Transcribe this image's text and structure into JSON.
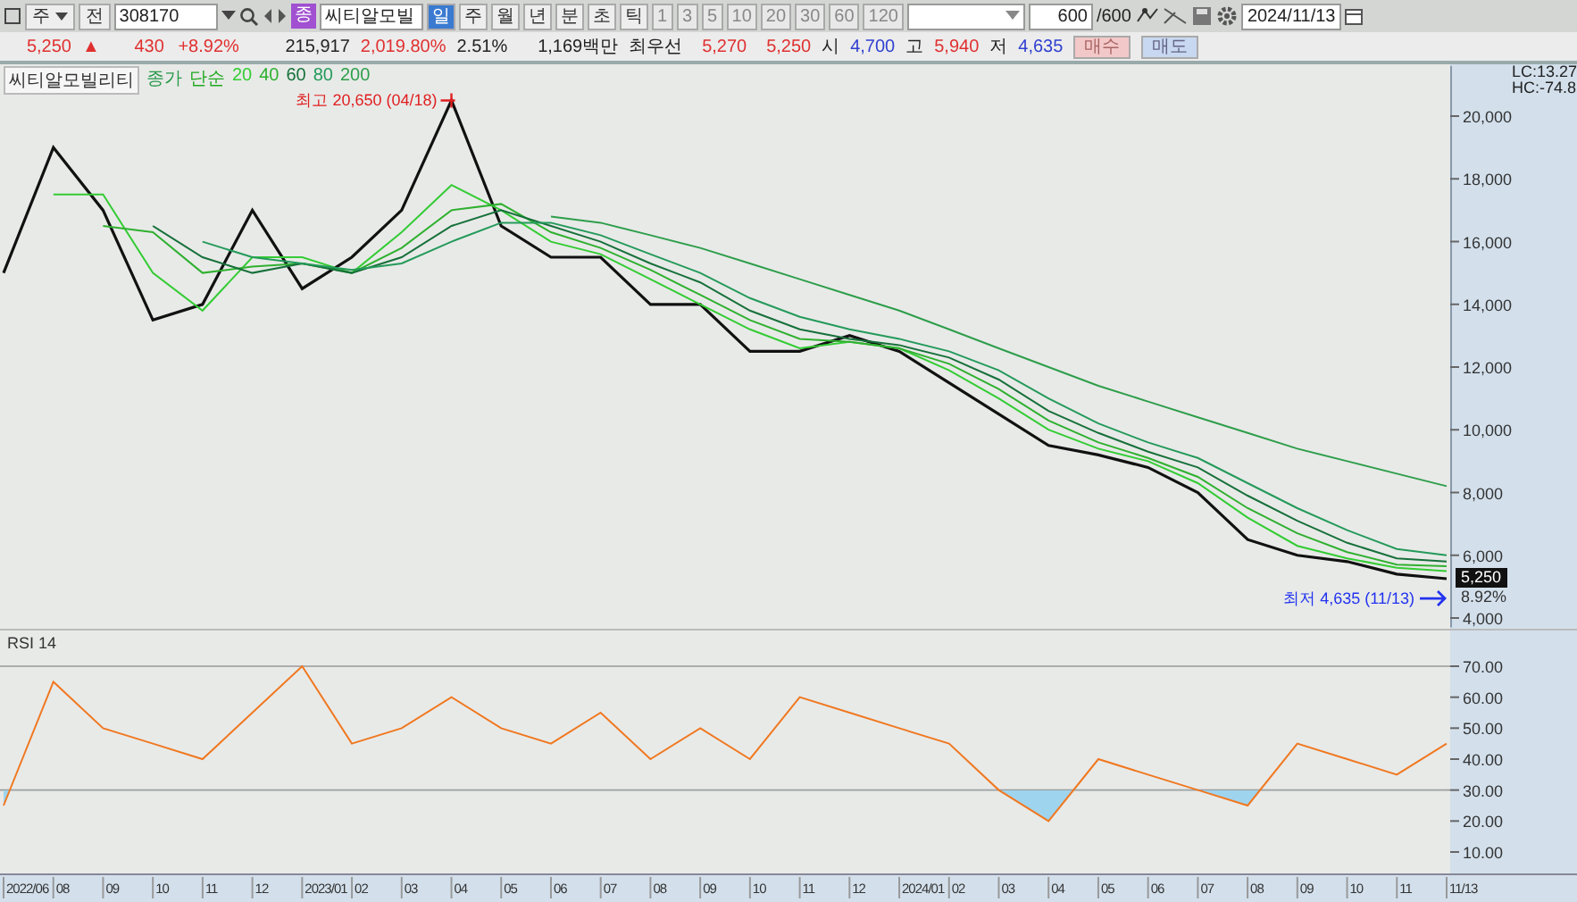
{
  "toolbar": {
    "market": "주",
    "type": "전",
    "code": "308170",
    "badge": "종",
    "name": "씨티알모빌",
    "periods": [
      {
        "label": "일",
        "selected": true
      },
      {
        "label": "주",
        "selected": false
      },
      {
        "label": "월",
        "selected": false
      },
      {
        "label": "년",
        "selected": false
      },
      {
        "label": "분",
        "selected": false
      },
      {
        "label": "초",
        "selected": false
      },
      {
        "label": "틱",
        "selected": false
      }
    ],
    "intervals": [
      {
        "label": "1",
        "selected": false
      },
      {
        "label": "3",
        "selected": false
      },
      {
        "label": "5",
        "selected": false
      },
      {
        "label": "10",
        "selected": false
      },
      {
        "label": "20",
        "selected": false
      },
      {
        "label": "30",
        "selected": false
      },
      {
        "label": "60",
        "selected": false
      },
      {
        "label": "120",
        "selected": false
      }
    ],
    "count": "600",
    "count_max": "/600",
    "date": "2024/11/13"
  },
  "quote": {
    "price": "5,250",
    "arrow": "▲",
    "change": "430",
    "change_pct": "+8.92%",
    "volume": "215,917",
    "volume_pct": "2,019.80%",
    "turnover": "2.51%",
    "amount": "1,169백만",
    "best_label": "최우선",
    "ask": "5,270",
    "bid": "5,250",
    "open_label": "시",
    "open": "4,700",
    "high_label": "고",
    "high": "5,940",
    "low_label": "저",
    "low": "4,635",
    "buttons": [
      {
        "label": "매수",
        "kind": "buy"
      },
      {
        "label": "매도",
        "kind": "sell"
      }
    ]
  },
  "price_pane": {
    "legend_name": "씨티알모빌리티",
    "legend_ma": "단순",
    "lc": "LC:13.27",
    "hc": "HC:-74.8",
    "high_mark": "최고 20,650 (04/18)",
    "low_mark": "최저 4,635 (11/13)",
    "price_tag": "5,250",
    "pct_tag": "8.92%",
    "chart_data": {
      "type": "line",
      "ylim": [
        3700,
        21600
      ],
      "yticks": [
        {
          "value": 20000,
          "label": "20,000"
        },
        {
          "value": 18000,
          "label": "18,000"
        },
        {
          "value": 16000,
          "label": "16,000"
        },
        {
          "value": 14000,
          "label": "14,000"
        },
        {
          "value": 12000,
          "label": "12,000"
        },
        {
          "value": 10000,
          "label": "10,000"
        },
        {
          "value": 8000,
          "label": "8,000"
        },
        {
          "value": 6000,
          "label": "6,000"
        },
        {
          "value": 4000,
          "label": "4,000"
        }
      ],
      "series": [
        {
          "name": "종가",
          "color": "#111111",
          "values": [
            15000,
            19000,
            17000,
            13500,
            14000,
            17000,
            14500,
            15500,
            17000,
            20500,
            16500,
            15500,
            15500,
            14000,
            14000,
            12500,
            12500,
            13000,
            12500,
            11500,
            10500,
            9500,
            9200,
            8800,
            8000,
            6500,
            6000,
            5800,
            5400,
            5250
          ]
        },
        {
          "name": "20",
          "color": "#33cc33",
          "values": [
            null,
            17500,
            17500,
            15000,
            13800,
            15500,
            15500,
            15000,
            16300,
            17800,
            17000,
            16000,
            15600,
            14800,
            14000,
            13200,
            12600,
            12800,
            12600,
            11900,
            11000,
            10000,
            9400,
            9000,
            8300,
            7200,
            6300,
            5900,
            5600,
            5500
          ]
        },
        {
          "name": "40",
          "color": "#2fb02f",
          "values": [
            null,
            null,
            16500,
            16300,
            15000,
            15200,
            15300,
            15000,
            15800,
            17000,
            17200,
            16300,
            15800,
            15100,
            14300,
            13500,
            12900,
            12800,
            12600,
            12100,
            11300,
            10300,
            9600,
            9100,
            8500,
            7500,
            6700,
            6100,
            5700,
            5650
          ]
        },
        {
          "name": "60",
          "color": "#17703a",
          "values": [
            null,
            null,
            null,
            16500,
            15500,
            15000,
            15300,
            15000,
            15500,
            16500,
            17000,
            16500,
            16000,
            15300,
            14700,
            13800,
            13200,
            12900,
            12700,
            12300,
            11600,
            10600,
            9900,
            9300,
            8800,
            7900,
            7100,
            6400,
            5900,
            5800
          ]
        },
        {
          "name": "80",
          "color": "#249a5a",
          "values": [
            null,
            null,
            null,
            null,
            16000,
            15500,
            15300,
            15100,
            15300,
            16000,
            16600,
            16600,
            16200,
            15600,
            15000,
            14200,
            13600,
            13200,
            12900,
            12500,
            11900,
            11000,
            10200,
            9600,
            9100,
            8300,
            7500,
            6800,
            6200,
            6000
          ]
        },
        {
          "name": "200",
          "color": "#2e9e4a",
          "values": [
            null,
            null,
            null,
            null,
            null,
            null,
            null,
            null,
            null,
            null,
            null,
            16800,
            16600,
            16200,
            15800,
            15300,
            14800,
            14300,
            13800,
            13200,
            12600,
            12000,
            11400,
            10900,
            10400,
            9900,
            9400,
            9000,
            8600,
            8200
          ]
        }
      ]
    }
  },
  "rsi_pane": {
    "chart_data": {
      "type": "line",
      "categories": [
        "2022/06",
        "08",
        "09",
        "10",
        "11",
        "12",
        "2023/01",
        "02",
        "03",
        "04",
        "05",
        "06",
        "07",
        "08",
        "09",
        "10",
        "11",
        "12",
        "2024/01",
        "02",
        "03",
        "04",
        "05",
        "06",
        "07",
        "08",
        "09",
        "10",
        "11",
        "11/13"
      ],
      "ylim": [
        10,
        70
      ],
      "yticks": [
        {
          "value": 70,
          "label": "70.00"
        },
        {
          "value": 60,
          "label": "60.00"
        },
        {
          "value": 50,
          "label": "50.00"
        },
        {
          "value": 40,
          "label": "40.00"
        },
        {
          "value": 30,
          "label": "30.00"
        },
        {
          "value": 20,
          "label": "20.00"
        },
        {
          "value": 10,
          "label": "10.00"
        }
      ],
      "series": [
        {
          "name": "RSI 14",
          "color": "#f07820",
          "values": [
            25,
            65,
            50,
            45,
            40,
            55,
            70,
            45,
            50,
            60,
            50,
            45,
            55,
            40,
            50,
            40,
            60,
            55,
            50,
            45,
            30,
            20,
            40,
            35,
            30,
            25,
            45,
            40,
            35,
            45
          ]
        }
      ]
    }
  }
}
